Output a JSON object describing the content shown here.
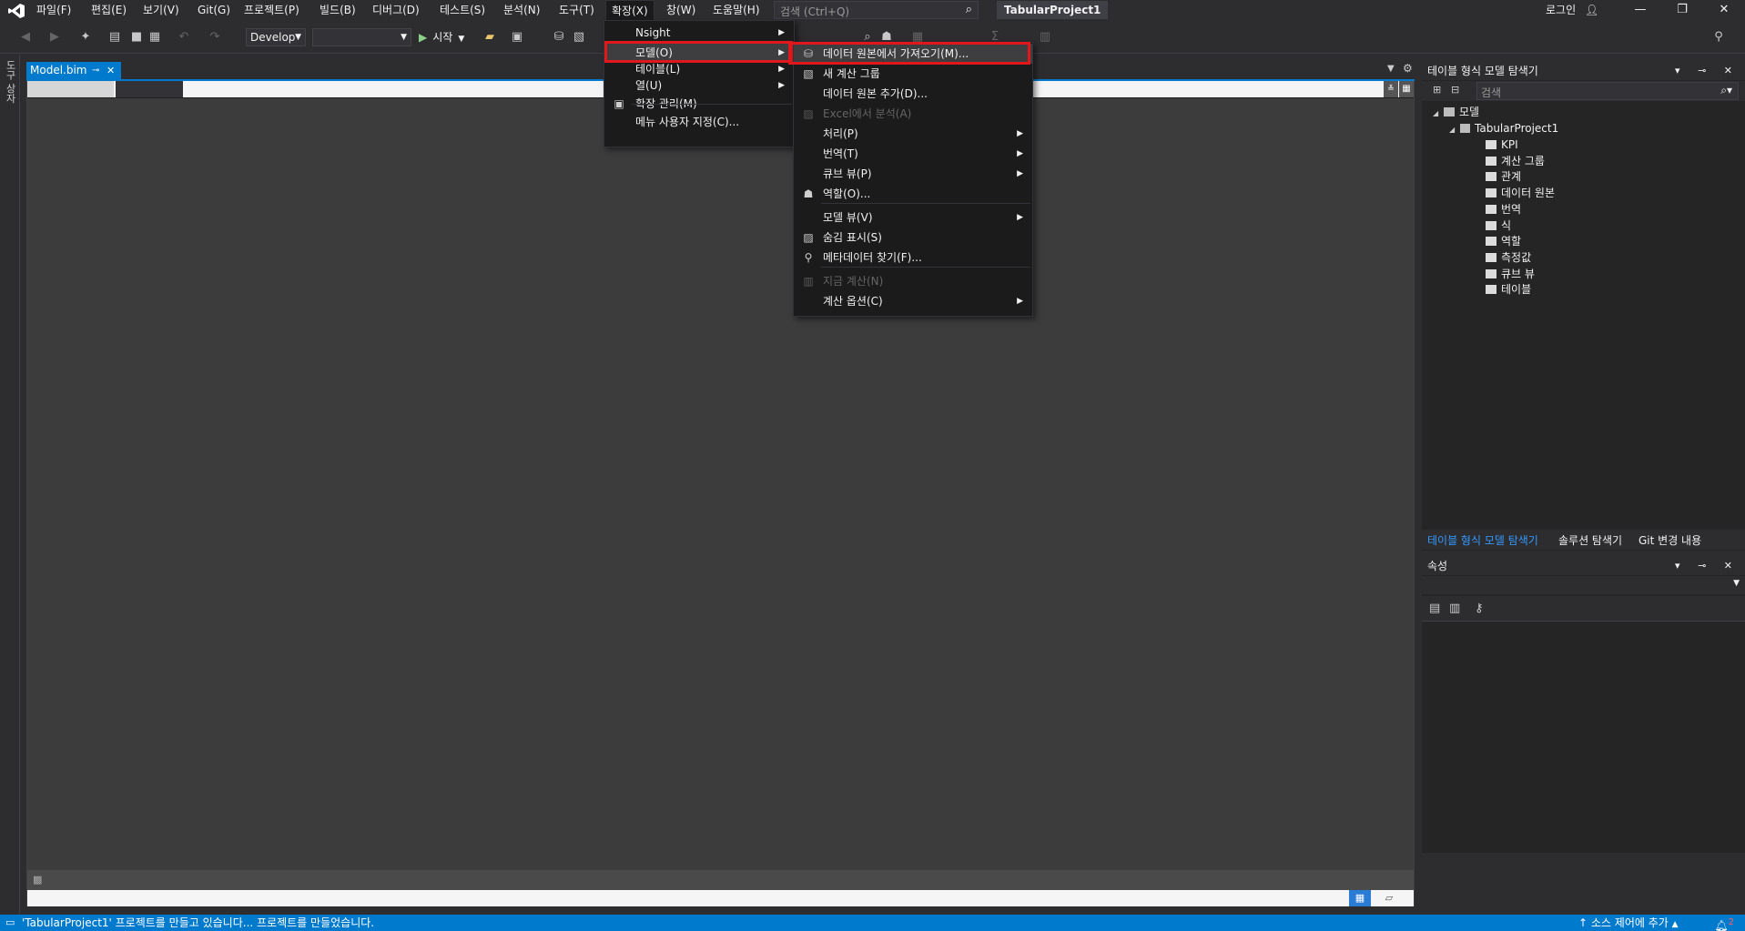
{
  "menubar": {
    "items": [
      "파일(F)",
      "편집(E)",
      "보기(V)",
      "Git(G)",
      "프로젝트(P)",
      "빌드(B)",
      "디버그(D)",
      "테스트(S)",
      "분석(N)",
      "도구(T)",
      "확장(X)",
      "창(W)",
      "도움말(H)"
    ],
    "search_placeholder": "검색 (Ctrl+Q)",
    "project_name": "TabularProject1",
    "login_label": "로그인"
  },
  "toolbar": {
    "config_value": "Develop",
    "platform_value": "",
    "start_label": "시작"
  },
  "left_strip": {
    "label": "도구 상자"
  },
  "document": {
    "tab_label": "Model.bim"
  },
  "extensions_menu": {
    "items": [
      {
        "label": "Nsight",
        "submenu": true,
        "icon": ""
      },
      {
        "label": "모델(O)",
        "submenu": true,
        "icon": ""
      },
      {
        "label": "테이블(L)",
        "submenu": true,
        "icon": ""
      },
      {
        "label": "열(U)",
        "submenu": true,
        "icon": ""
      },
      {
        "label": "확장 관리(M)",
        "submenu": false,
        "icon": "extensions-icon"
      },
      {
        "label": "메뉴 사용자 지정(C)...",
        "submenu": false,
        "icon": ""
      }
    ]
  },
  "model_submenu": {
    "items": [
      {
        "label": "데이터 원본에서 가져오기(M)...",
        "icon": "database-icon",
        "submenu": false,
        "disabled": false
      },
      {
        "label": "새 계산 그룹",
        "icon": "calc-group-icon",
        "submenu": false,
        "disabled": false
      },
      {
        "label": "데이터 원본 추가(D)...",
        "icon": "",
        "submenu": false,
        "disabled": false
      },
      {
        "label": "Excel에서 분석(A)",
        "icon": "excel-icon",
        "submenu": false,
        "disabled": true
      },
      {
        "label": "처리(P)",
        "icon": "",
        "submenu": true,
        "disabled": false
      },
      {
        "label": "번역(T)",
        "icon": "",
        "submenu": true,
        "disabled": false
      },
      {
        "label": "큐브 뷰(P)",
        "icon": "",
        "submenu": true,
        "disabled": false
      },
      {
        "label": "역할(O)...",
        "icon": "roles-icon",
        "submenu": false,
        "disabled": false
      },
      {
        "label": "모델 뷰(V)",
        "icon": "",
        "submenu": true,
        "disabled": false
      },
      {
        "label": "숨김 표시(S)",
        "icon": "show-hidden-icon",
        "submenu": false,
        "disabled": false
      },
      {
        "label": "메타데이터 찾기(F)...",
        "icon": "search-icon",
        "submenu": false,
        "disabled": false
      },
      {
        "label": "지금 계산(N)",
        "icon": "calculate-icon",
        "submenu": false,
        "disabled": true
      },
      {
        "label": "계산 옵션(C)",
        "icon": "",
        "submenu": true,
        "disabled": false
      }
    ]
  },
  "explorer": {
    "title": "테이블 형식 모델 탐색기",
    "search_placeholder": "검색",
    "root_label": "모델",
    "project_label": "TabularProject1",
    "children": [
      "KPI",
      "계산 그룹",
      "관계",
      "데이터 원본",
      "번역",
      "식",
      "역할",
      "측정값",
      "큐브 뷰",
      "테이블"
    ],
    "tabs": [
      "테이블 형식 모델 탐색기",
      "솔루션 탐색기",
      "Git 변경 내용"
    ]
  },
  "properties": {
    "title": "속성"
  },
  "statusbar": {
    "message": "'TabularProject1' 프로젝트를 만들고 있습니다... 프로젝트를 만들었습니다.",
    "source_control": "소스 제어에 추가",
    "notification_count": "2"
  }
}
